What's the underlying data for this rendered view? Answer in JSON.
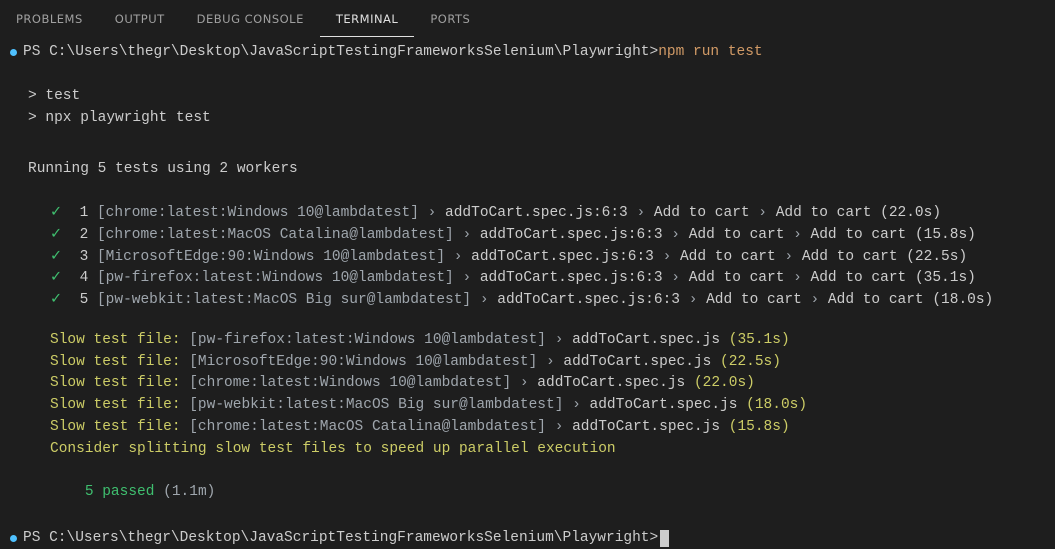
{
  "tabs": {
    "problems": "PROBLEMS",
    "output": "OUTPUT",
    "debug_console": "DEBUG CONSOLE",
    "terminal": "TERMINAL",
    "ports": "PORTS"
  },
  "prompt1": {
    "text": "PS C:\\Users\\thegr\\Desktop\\JavaScriptTestingFrameworksSelenium\\Playwright> ",
    "command": "npm run test"
  },
  "script": {
    "l1": "> test",
    "l2": "> npx playwright test"
  },
  "running": "Running 5 tests using 2 workers",
  "tests": [
    {
      "check": "✓",
      "n": "1",
      "b": "[chrome:latest:Windows 10@lambdatest]",
      "p": "addToCart.spec.js:6:3",
      "d1": "Add to cart",
      "d2": "Add to cart",
      "t": "(22.0s)"
    },
    {
      "check": "✓",
      "n": "2",
      "b": "[chrome:latest:MacOS Catalina@lambdatest]",
      "p": "addToCart.spec.js:6:3",
      "d1": "Add to cart",
      "d2": "Add to cart",
      "t": "(15.8s)"
    },
    {
      "check": "✓",
      "n": "3",
      "b": "[MicrosoftEdge:90:Windows 10@lambdatest]",
      "p": "addToCart.spec.js:6:3",
      "d1": "Add to cart",
      "d2": "Add to cart",
      "t": "(22.5s)"
    },
    {
      "check": "✓",
      "n": "4",
      "b": "[pw-firefox:latest:Windows 10@lambdatest]",
      "p": "addToCart.spec.js:6:3",
      "d1": "Add to cart",
      "d2": "Add to cart",
      "t": "(35.1s)"
    },
    {
      "check": "✓",
      "n": "5",
      "b": "[pw-webkit:latest:MacOS Big sur@lambdatest]",
      "p": "addToCart.spec.js:6:3",
      "d1": "Add to cart",
      "d2": "Add to cart",
      "t": "(18.0s)"
    }
  ],
  "slow": [
    {
      "label": "Slow test file:",
      "b": "[pw-firefox:latest:Windows 10@lambdatest]",
      "p": "addToCart.spec.js",
      "t": "(35.1s)"
    },
    {
      "label": "Slow test file:",
      "b": "[MicrosoftEdge:90:Windows 10@lambdatest]",
      "p": "addToCart.spec.js",
      "t": "(22.5s)"
    },
    {
      "label": "Slow test file:",
      "b": "[chrome:latest:Windows 10@lambdatest]",
      "p": "addToCart.spec.js",
      "t": "(22.0s)"
    },
    {
      "label": "Slow test file:",
      "b": "[pw-webkit:latest:MacOS Big sur@lambdatest]",
      "p": "addToCart.spec.js",
      "t": "(18.0s)"
    },
    {
      "label": "Slow test file:",
      "b": "[chrome:latest:MacOS Catalina@lambdatest]",
      "p": "addToCart.spec.js",
      "t": "(15.8s)"
    }
  ],
  "consider": "Consider splitting slow test files to speed up parallel execution",
  "result": {
    "passed": "5 passed",
    "time": " (1.1m)"
  },
  "prompt2": "PS C:\\Users\\thegr\\Desktop\\JavaScriptTestingFrameworksSelenium\\Playwright> "
}
